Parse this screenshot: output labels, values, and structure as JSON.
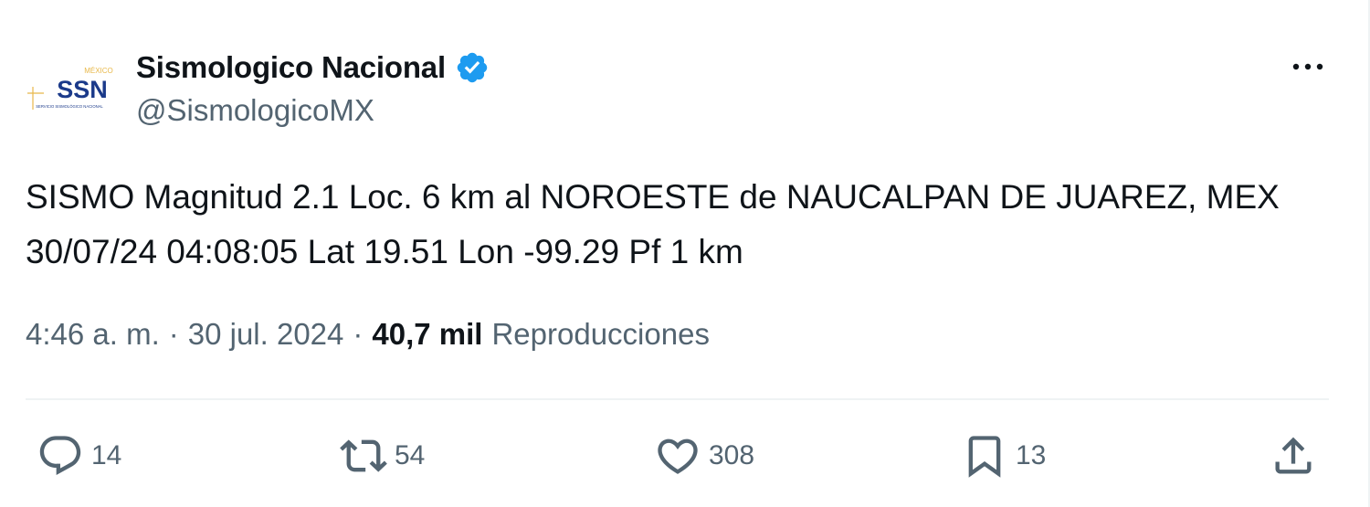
{
  "author": {
    "display_name": "Sismologico Nacional",
    "handle": "@SismologicoMX",
    "verified": true,
    "avatar_logo": {
      "top_text": "MÉXICO",
      "main_text": "SSN",
      "sub_text": "SERVICIO SISMOLÓGICO NACIONAL"
    }
  },
  "more_icon": "more-horizontal-icon",
  "tweet": {
    "text": "SISMO Magnitud 2.1 Loc. 6 km al NOROESTE de NAUCALPAN DE JUAREZ, MEX 30/07/24 04:08:05 Lat 19.51 Lon -99.29 Pf 1 km"
  },
  "meta": {
    "time": "4:46 a. m.",
    "separator": "·",
    "date": "30 jul. 2024",
    "views_count": "40,7 mil",
    "views_label": "Reproducciones"
  },
  "actions": {
    "reply": {
      "icon": "reply-icon",
      "count": "14"
    },
    "retweet": {
      "icon": "retweet-icon",
      "count": "54"
    },
    "like": {
      "icon": "heart-icon",
      "count": "308"
    },
    "bookmark": {
      "icon": "bookmark-icon",
      "count": "13"
    },
    "share": {
      "icon": "share-icon"
    }
  },
  "colors": {
    "text_primary": "#0f1419",
    "text_secondary": "#536471",
    "verified_blue": "#1d9bf0",
    "divider": "#eff3f4",
    "logo_navy": "#1b3a8a",
    "logo_gold": "#e8b84a"
  }
}
